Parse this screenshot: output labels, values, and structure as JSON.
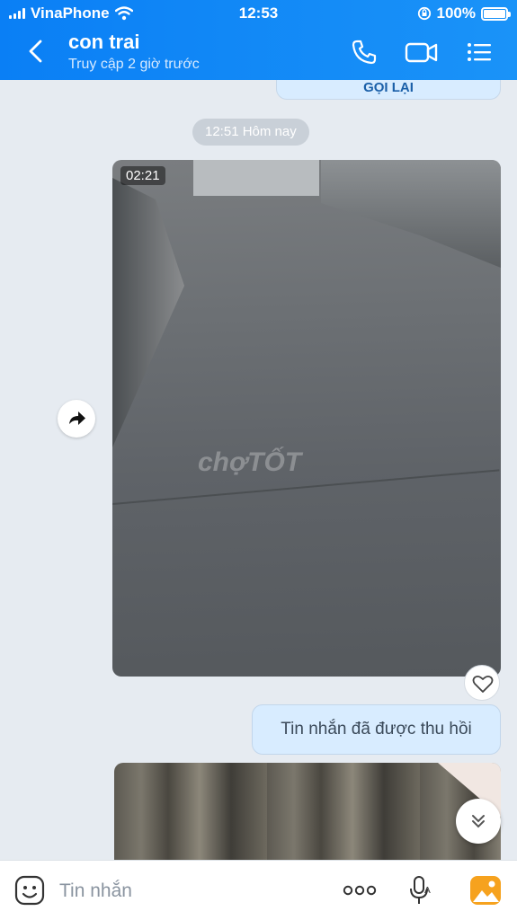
{
  "status_bar": {
    "carrier": "VinaPhone",
    "time": "12:53",
    "battery": "100%"
  },
  "header": {
    "contact_name": "con trai",
    "last_seen": "Truy cập 2 giờ trước"
  },
  "chat": {
    "call_back_label": "GỌI LẠI",
    "timestamp_chip": "12:51 Hôm nay",
    "video": {
      "duration": "02:21",
      "watermark": "chợTỐT"
    },
    "recalled_message": "Tin nhắn đã được thu hồi"
  },
  "input_bar": {
    "placeholder": "Tin nhắn"
  },
  "colors": {
    "header_blue": "#0a7ff5",
    "bubble_blue": "#d8ecff",
    "chat_bg": "#e6ebf1"
  }
}
